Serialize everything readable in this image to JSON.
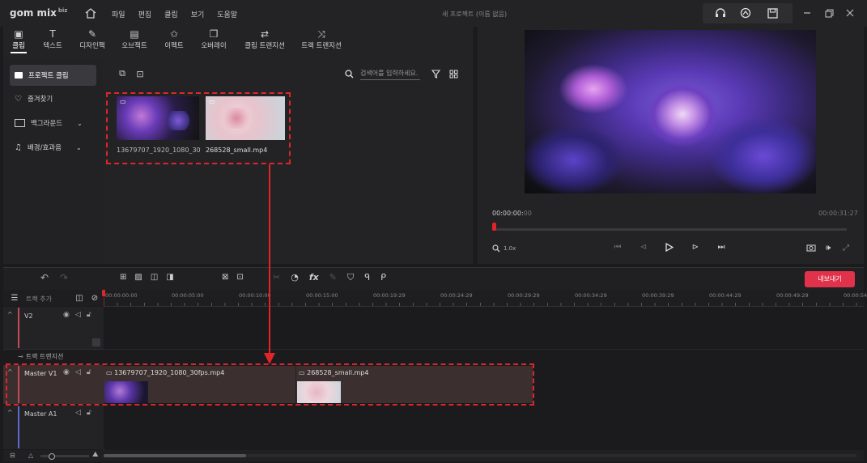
{
  "app": {
    "logo": "gom mix",
    "logo_badge": "biz",
    "title": "새 프로젝트 (이름 없음)",
    "menu": [
      "파일",
      "편집",
      "클립",
      "보기",
      "도움말"
    ]
  },
  "tabs": [
    {
      "label": "클립",
      "icon": "clip-icon"
    },
    {
      "label": "텍스트",
      "icon": "text-icon"
    },
    {
      "label": "디자인팩",
      "icon": "design-icon"
    },
    {
      "label": "오브젝트",
      "icon": "object-icon"
    },
    {
      "label": "이펙트",
      "icon": "effect-icon"
    },
    {
      "label": "오버레이",
      "icon": "overlay-icon"
    },
    {
      "label": "클립 트랜지션",
      "icon": "clip-transition-icon"
    },
    {
      "label": "트랙 트랜지션",
      "icon": "track-transition-icon"
    }
  ],
  "sidebar": {
    "items": [
      {
        "label": "프로젝트 클립",
        "icon": "folder-icon"
      },
      {
        "label": "즐겨찾기",
        "icon": "heart-icon"
      },
      {
        "label": "백그라운드",
        "icon": "background-icon"
      },
      {
        "label": "배경/효과음",
        "icon": "music-icon"
      }
    ]
  },
  "media": {
    "search_placeholder": "검색어를 입력하세요.",
    "clips": [
      {
        "name": "13679707_1920_1080_30f..."
      },
      {
        "name": "268528_small.mp4"
      }
    ]
  },
  "preview": {
    "current_time": "00:00:00",
    "current_frame": "00",
    "total_time": "00:00:31:27",
    "zoom": "1.0x",
    "progress": 0.0
  },
  "timeline": {
    "add_track": "트랙 추가",
    "export_label": "내보내기",
    "ruler": [
      "00:00:00:00",
      "00:00:05:00",
      "00:00:10:00",
      "00:00:15:00",
      "00:00:19:29",
      "00:00:24:29",
      "00:00:29:29",
      "00:00:34:29",
      "00:00:39:29",
      "00:00:44:29",
      "00:00:49:29",
      "00:00:54"
    ],
    "tracks": {
      "v2": "V2",
      "transition": "트랙 트랜지션",
      "master_v1": "Master V1",
      "master_a1": "Master A1"
    },
    "clips": [
      {
        "name": "13679707_1920_1080_30fps.mp4"
      },
      {
        "name": "268528_small.mp4"
      }
    ]
  },
  "colors": {
    "accent_red": "#e0252a",
    "export_button": "#e0334b"
  }
}
